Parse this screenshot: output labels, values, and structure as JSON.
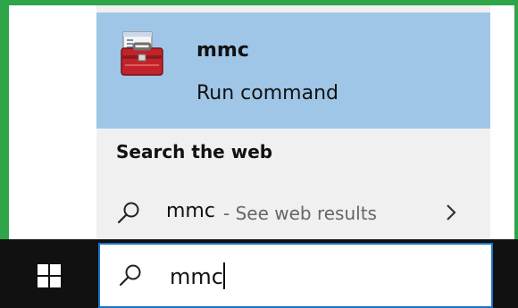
{
  "best_match": {
    "app_name": "mmc",
    "app_subtitle": "Run command",
    "icon": "toolbox-icon"
  },
  "web_section": {
    "heading": "Search the web",
    "result": {
      "query": "mmc",
      "hint": " - See web results",
      "search_icon": "search-icon",
      "chevron_icon": "chevron-right-icon"
    }
  },
  "taskbar": {
    "start_icon": "windows-logo-icon",
    "search_icon": "search-icon",
    "search_value": "mmc"
  },
  "colors": {
    "frame": "#2ea548",
    "selection": "#9fc6e7",
    "panel": "#f0f0f0",
    "taskbar": "#111111",
    "search_border": "#1a73c7"
  }
}
